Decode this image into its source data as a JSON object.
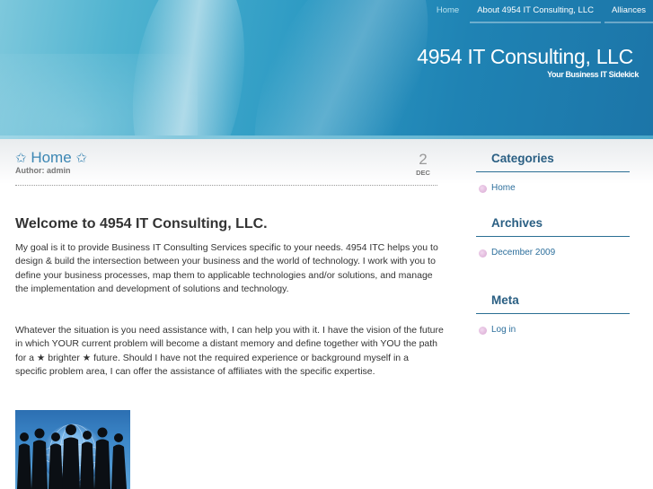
{
  "nav": {
    "items": [
      {
        "label": "Home",
        "active": true
      },
      {
        "label": "About 4954 IT Consulting, LLC",
        "active": false
      },
      {
        "label": "Alliances",
        "active": false
      }
    ]
  },
  "site": {
    "title": "4954 IT Consulting, LLC",
    "tagline": "Your Business IT Sidekick"
  },
  "post": {
    "title": "Home",
    "title_star": "✩",
    "author": "Author: admin",
    "date_day": "2",
    "date_month": "DEC",
    "heading": "Welcome to 4954 IT Consulting, LLC.",
    "para1_lines": [
      "My goal is it to provide Business IT Consulting Services specific to your needs.  4954 ITC helps you to",
      "design & build the intersection between your business and the world of technology. I work with you to",
      "define your business processes, map them to applicable technologies and/or solutions, and manage",
      "the implementation and development of solutions and technology."
    ],
    "para2_lines": [
      "Whatever the situation is you need assistance with, I can help you with it. I have the vision of the future",
      "in which YOUR current problem will become a distant memory and define together with YOU the path",
      "for a ★ brighter ★ future. Should I have not the required experience or background myself in a",
      "specific problem area, I can offer the assistance of affiliates with the specific expertise."
    ]
  },
  "sidebar": {
    "categories": {
      "heading": "Categories",
      "items": [
        "Home"
      ]
    },
    "archives": {
      "heading": "Archives",
      "items": [
        "December 2009"
      ]
    },
    "meta": {
      "heading": "Meta",
      "items": [
        "Log in"
      ]
    }
  },
  "colors": {
    "link": "#3b86b3",
    "sidebar_heading": "#2a5f83",
    "header_blue": "#1f83b4"
  }
}
